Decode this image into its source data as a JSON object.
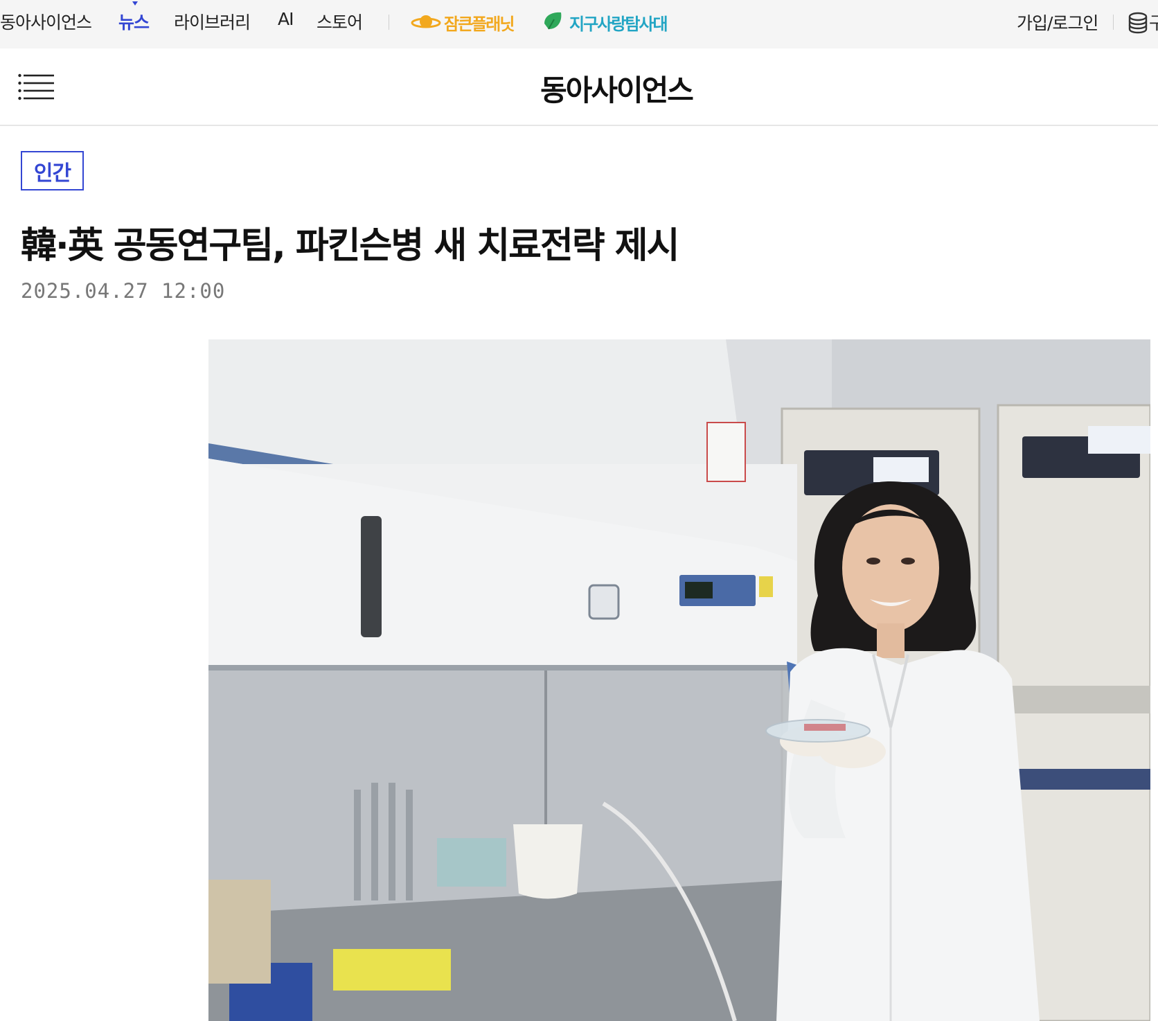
{
  "topbar": {
    "brand": "동아사이언스",
    "nav": [
      {
        "label": "뉴스",
        "active": true
      },
      {
        "label": "라이브러리",
        "active": false
      },
      {
        "label": "AI",
        "active": false
      },
      {
        "label": "스토어",
        "active": false
      }
    ],
    "promos": [
      {
        "name": "잠큰플래닛",
        "icon": "planet-icon"
      },
      {
        "name": "지구사랑탐사대",
        "icon": "leaf-icon"
      }
    ],
    "login_label": "가입/로그인",
    "edge_glyph": "구",
    "active_color": "#3346d3"
  },
  "header": {
    "site_title": "동아사이언스",
    "menu_icon": "menu-icon"
  },
  "article": {
    "category": "인간",
    "headline": "韓·英 공동연구팀, 파킨슨병 새 치료전략 제시",
    "date": "2025.04.27 12:00",
    "photo_icon": "lab-photo"
  }
}
